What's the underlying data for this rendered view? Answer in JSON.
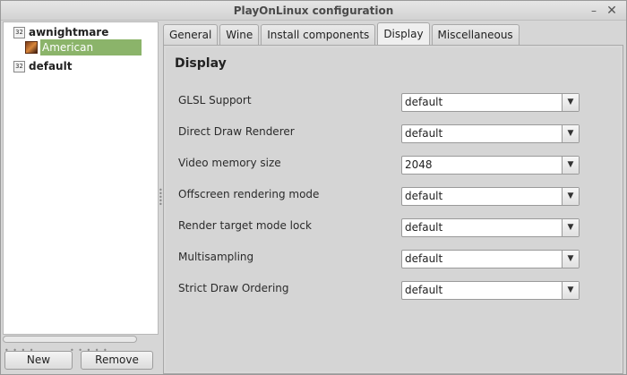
{
  "window": {
    "title": "PlayOnLinux configuration",
    "minimize": "–",
    "close": "✕"
  },
  "sidebar": {
    "items": [
      {
        "badge": "32",
        "label": "awnightmare"
      },
      {
        "label": "American Nightmare"
      },
      {
        "badge": "32",
        "label": "default"
      }
    ],
    "new_label": "New",
    "remove_label": "Remove"
  },
  "tabs": [
    {
      "label": "General"
    },
    {
      "label": "Wine"
    },
    {
      "label": "Install components"
    },
    {
      "label": "Display"
    },
    {
      "label": "Miscellaneous"
    }
  ],
  "display": {
    "title": "Display",
    "settings": [
      {
        "label": "GLSL Support",
        "value": "default"
      },
      {
        "label": "Direct Draw Renderer",
        "value": "default"
      },
      {
        "label": "Video memory size",
        "value": "2048"
      },
      {
        "label": "Offscreen rendering mode",
        "value": "default"
      },
      {
        "label": "Render target mode lock",
        "value": "default"
      },
      {
        "label": "Multisampling",
        "value": "default"
      },
      {
        "label": "Strict Draw Ordering",
        "value": "default"
      }
    ],
    "arrow": "▼"
  },
  "colors": {
    "selection": "#8bb46a"
  }
}
